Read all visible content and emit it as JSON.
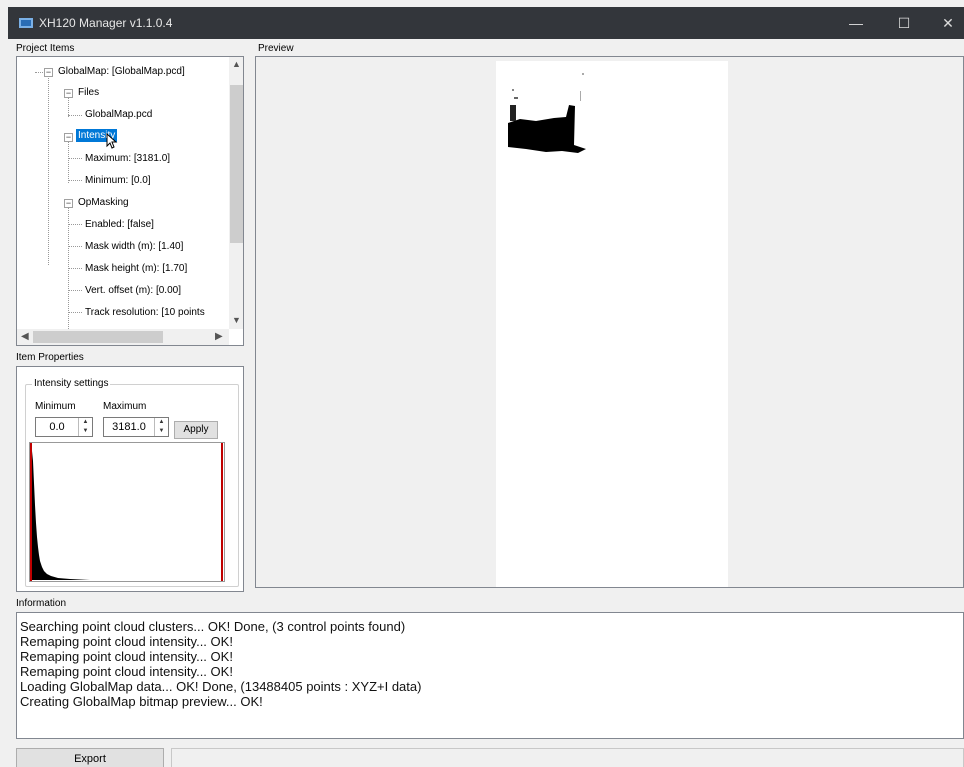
{
  "window": {
    "title": "XH120 Manager v1.1.0.4",
    "minimize_glyph": "—",
    "maximize_glyph": "☐",
    "close_glyph": "✕"
  },
  "sections": {
    "project_items": "Project Items",
    "preview": "Preview",
    "item_properties": "Item Properties",
    "information": "Information"
  },
  "tree": {
    "root": "GlobalMap: [GlobalMap.pcd]",
    "files": "Files",
    "files_child": "GlobalMap.pcd",
    "intensity": "Intensity",
    "intensity_max": "Maximum: [3181.0]",
    "intensity_min": "Minimum: [0.0]",
    "opmasking": "OpMasking",
    "enabled": "Enabled: [false]",
    "mask_width": "Mask width (m): [1.40]",
    "mask_height": "Mask height (m): [1.70]",
    "vert_offset": "Vert. offset (m): [0.00]",
    "track_resolution": "Track resolution: [10 points"
  },
  "properties": {
    "group_title": "Intensity settings",
    "minimum_label": "Minimum",
    "maximum_label": "Maximum",
    "minimum_value": "0.0",
    "maximum_value": "3181.0",
    "apply": "Apply"
  },
  "information": {
    "lines": [
      "Searching point cloud clusters... OK! Done, (3 control points found)",
      "Remaping point cloud intensity... OK!",
      "Remaping point cloud intensity... OK!",
      "Remaping point cloud intensity... OK!",
      "Loading GlobalMap data... OK! Done, (13488405 points : XYZ+I data)",
      "Creating GlobalMap bitmap preview... OK!"
    ]
  },
  "footer": {
    "export": "Export"
  },
  "colors": {
    "titlebar": "#33363b",
    "selection": "#0078d7",
    "histogram_marker": "#c00000"
  }
}
